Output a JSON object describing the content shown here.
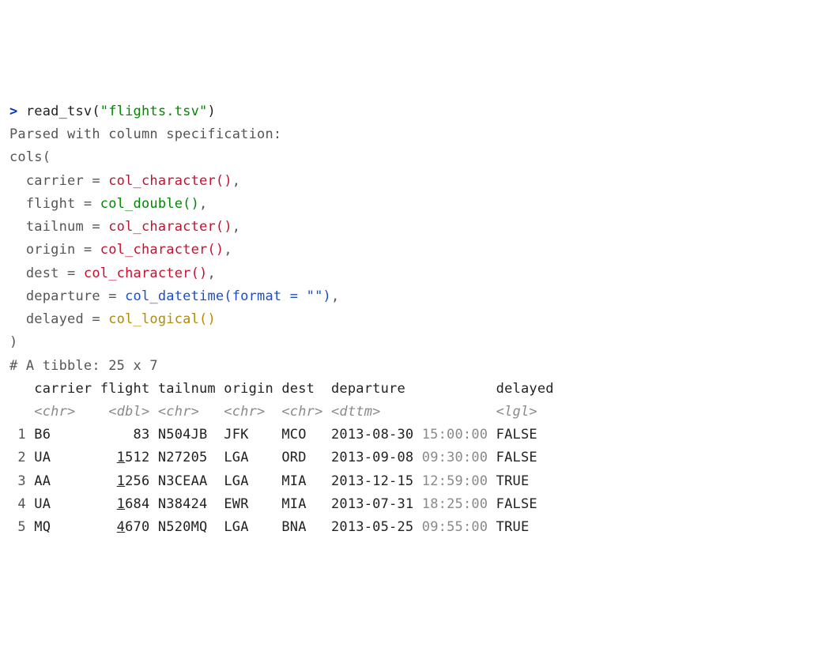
{
  "console": {
    "prompt": ">",
    "command": "read_tsv(\"flights.tsv\")",
    "fn": "read_tsv",
    "arg": "\"flights.tsv\"",
    "parsed_line": "Parsed with column specification:",
    "cols_open": "cols(",
    "spec": [
      {
        "name": "carrier",
        "type": "col_character()",
        "class": "red"
      },
      {
        "name": "flight",
        "type": "col_double()",
        "class": "green"
      },
      {
        "name": "tailnum",
        "type": "col_character()",
        "class": "red"
      },
      {
        "name": "origin",
        "type": "col_character()",
        "class": "red"
      },
      {
        "name": "dest",
        "type": "col_character()",
        "class": "red"
      },
      {
        "name": "departure",
        "type": "col_datetime(format = \"\")",
        "class": "blue"
      },
      {
        "name": "delayed",
        "type": "col_logical()",
        "class": "gold"
      }
    ],
    "cols_close": ")",
    "tibble_header": "# A tibble: 25 x 7",
    "col_header": "   carrier flight tailnum origin dest  departure           delayed",
    "type_header": "   <chr>    <dbl> <chr>   <chr>  <chr> <dttm>              <lgl>  ",
    "rows": [
      {
        "idx": " 1",
        "carrier": "B6",
        "flight_lead": "  ",
        "flight_num": "83",
        "tailnum": "N504JB",
        "origin": "JFK",
        "dest": "MCO",
        "date": "2013-08-30",
        "time": "15:00:00",
        "delayed": "FALSE"
      },
      {
        "idx": " 2",
        "carrier": "UA",
        "flight_lead": "",
        "flight_num": "1512",
        "tailnum": "N27205",
        "origin": "LGA",
        "dest": "ORD",
        "date": "2013-09-08",
        "time": "09:30:00",
        "delayed": "FALSE"
      },
      {
        "idx": " 3",
        "carrier": "AA",
        "flight_lead": "",
        "flight_num": "1256",
        "tailnum": "N3CEAA",
        "origin": "LGA",
        "dest": "MIA",
        "date": "2013-12-15",
        "time": "12:59:00",
        "delayed": "TRUE "
      },
      {
        "idx": " 4",
        "carrier": "UA",
        "flight_lead": "",
        "flight_num": "1684",
        "tailnum": "N38424",
        "origin": "EWR",
        "dest": "MIA",
        "date": "2013-07-31",
        "time": "18:25:00",
        "delayed": "FALSE"
      },
      {
        "idx": " 5",
        "carrier": "MQ",
        "flight_lead": "",
        "flight_num": "4670",
        "tailnum": "N520MQ",
        "origin": "LGA",
        "dest": "BNA",
        "date": "2013-05-25",
        "time": "09:55:00",
        "delayed": "TRUE "
      }
    ]
  }
}
